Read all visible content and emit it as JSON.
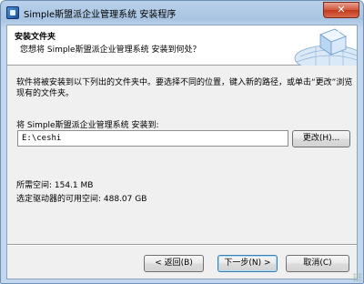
{
  "window": {
    "title": "Simple斯盟派企业管理系统 安装程序",
    "close_label": "✕"
  },
  "header": {
    "title": "安装文件夹",
    "subtitle": "您想将 Simple斯盟派企业管理系统 安装到何处？",
    "logo_icon": "globe-box-icon"
  },
  "content": {
    "description": "软件将被安装到以下列出的文件夹中。要选择不同的位置，键入新的路径，或单击“更改”浏览现有的文件夹。",
    "destination_label": "将 Simple斯盟派企业管理系统 安装到:",
    "path_value": "E:\\ceshi",
    "browse_label": "更改(H)...",
    "required_space": "所需空间: 154.1 MB",
    "free_space": "选定驱动器的可用空间: 488.07 GB"
  },
  "buttons": {
    "back_label": "< 返回(B)",
    "next_label": "下一步(N) >",
    "cancel_label": "取消(C)"
  },
  "colors": {
    "title_bar": "#b9d1ea",
    "close_button": "#d2553a",
    "default_button_border": "#3c7fb1"
  }
}
